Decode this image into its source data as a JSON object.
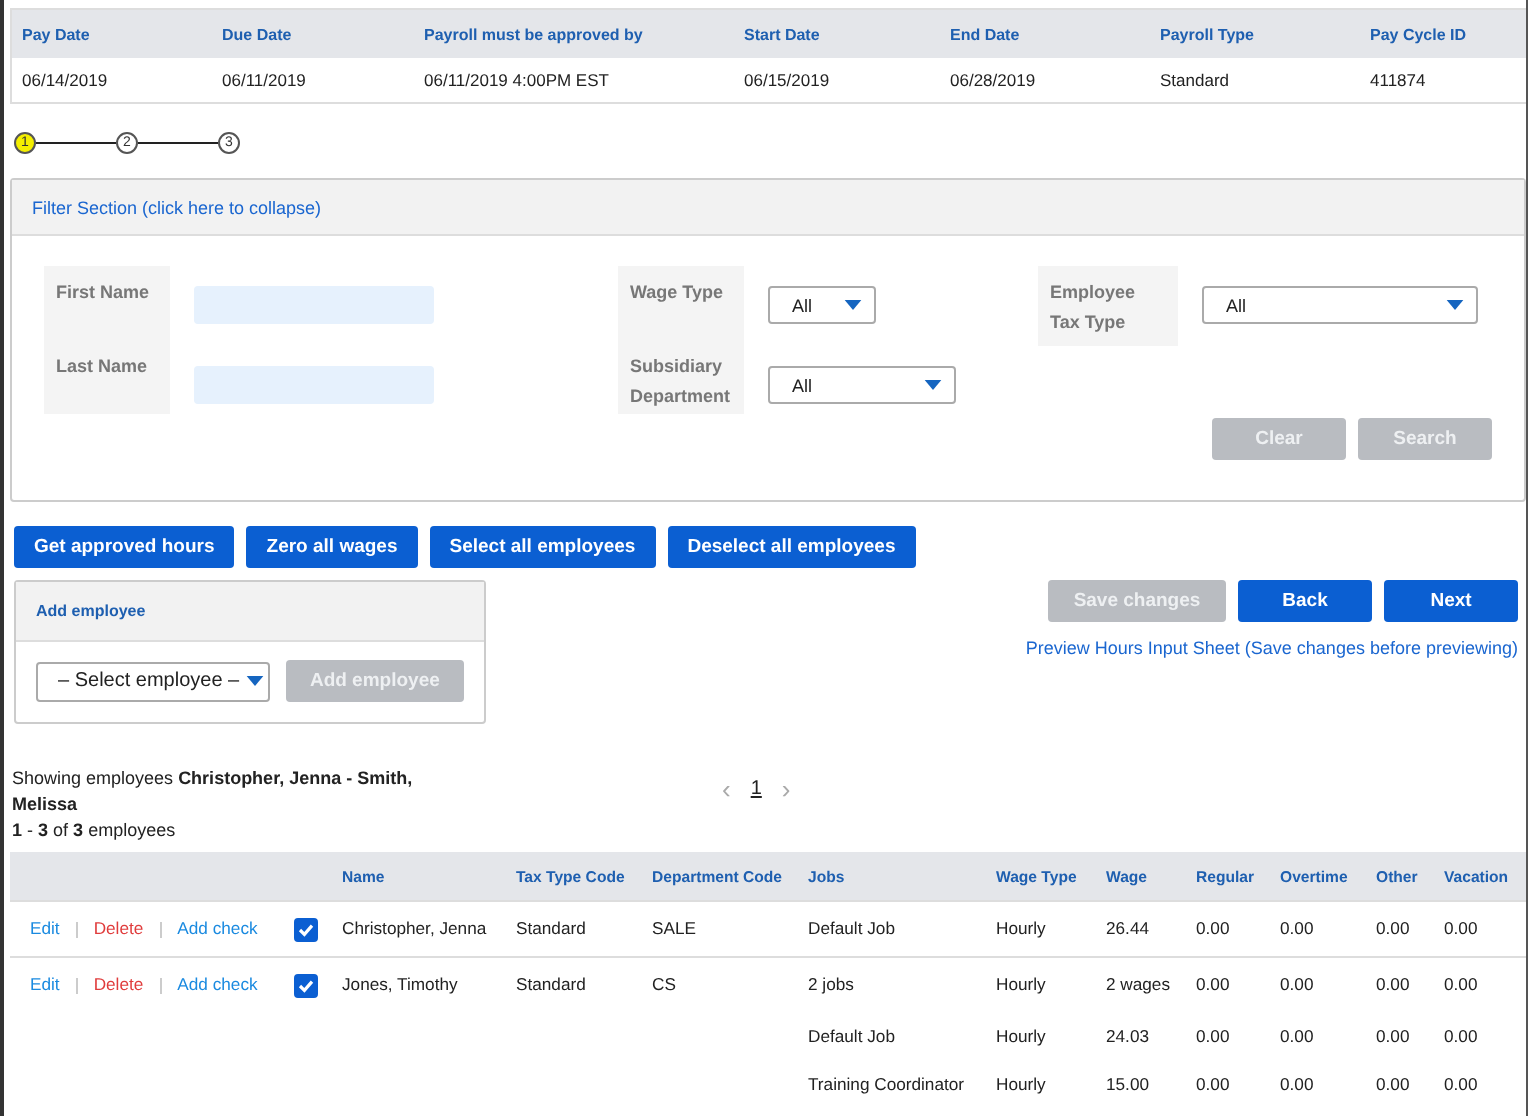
{
  "summary": {
    "columns": [
      "Pay Date",
      "Due Date",
      "Payroll must be approved by",
      "Start Date",
      "End Date",
      "Payroll Type",
      "Pay Cycle ID"
    ],
    "row": [
      "06/14/2019",
      "06/11/2019",
      "06/11/2019 4:00PM EST",
      "06/15/2019",
      "06/28/2019",
      "Standard",
      "411874"
    ]
  },
  "steps": [
    {
      "label": "1",
      "selected": true
    },
    {
      "label": "2",
      "selected": false
    },
    {
      "label": "3",
      "selected": false
    }
  ],
  "filter": {
    "title": "Filter Section (click here to collapse)",
    "text_fields": [
      {
        "label": "First Name"
      },
      {
        "label": "Last Name"
      }
    ],
    "middle_selects": [
      {
        "label": "Wage Type",
        "value": "All"
      },
      {
        "label": "Subsidiary Department",
        "value": "All"
      }
    ],
    "right_selects": [
      {
        "label": "Employee Tax Type",
        "value": "All"
      }
    ],
    "buttons": [
      {
        "label": "Clear",
        "disabled": true
      },
      {
        "label": "Search",
        "disabled": true
      }
    ]
  },
  "actions": [
    {
      "label": "Get approved hours",
      "disabled": false
    },
    {
      "label": "Zero all wages",
      "disabled": false
    },
    {
      "label": "Select all employees",
      "disabled": false
    },
    {
      "label": "Deselect all employees",
      "disabled": false
    }
  ],
  "add_employee": {
    "title": "Add employee",
    "select_value": "– Select employee –",
    "button": {
      "label": "Add employee",
      "disabled": true
    }
  },
  "nav_buttons": [
    {
      "label": "Save changes",
      "disabled": true
    },
    {
      "label": "Back",
      "disabled": false
    },
    {
      "label": "Next",
      "disabled": false
    }
  ],
  "preview_link": "Preview Hours Input Sheet (Save changes before previewing)",
  "showing": "Showing employees **Christopher, Jenna - Smith, Melissa**",
  "count": "**1** - **3** of **3** employees",
  "pager": {
    "prev": "‹",
    "pages": [
      {
        "label": "1",
        "selected": true
      }
    ],
    "next": "›"
  },
  "table": {
    "columns": [
      "Name",
      "Tax Type Code",
      "Department Code",
      "Jobs",
      "Wage Type",
      "Wage",
      "Regular",
      "Overtime",
      "Other",
      "Vacation"
    ],
    "rows": [
      {
        "actions": [
          {
            "label": "Edit",
            "kind": "link"
          },
          {
            "label": "Delete",
            "kind": "danger"
          },
          {
            "label": "Add check",
            "kind": "link"
          }
        ],
        "checked": true,
        "name": "Christopher, Jenna",
        "tax_type_code": "Standard",
        "department_code": "SALE",
        "lines": [
          [
            "Default Job",
            "Hourly",
            "26.44",
            "0.00",
            "0.00",
            "0.00",
            "0.00"
          ]
        ]
      },
      {
        "actions": [
          {
            "label": "Edit",
            "kind": "link"
          },
          {
            "label": "Delete",
            "kind": "danger"
          },
          {
            "label": "Add check",
            "kind": "link"
          }
        ],
        "checked": true,
        "name": "Jones, Timothy",
        "tax_type_code": "Standard",
        "department_code": "CS",
        "lines": [
          [
            "2 jobs",
            "Hourly",
            "2 wages",
            "0.00",
            "0.00",
            "0.00",
            "0.00"
          ],
          [
            "Default Job",
            "Hourly",
            "24.03",
            "0.00",
            "0.00",
            "0.00",
            "0.00"
          ],
          [
            "Training Coordinator",
            "Hourly",
            "15.00",
            "0.00",
            "0.00",
            "0.00",
            "0.00"
          ]
        ]
      }
    ]
  }
}
